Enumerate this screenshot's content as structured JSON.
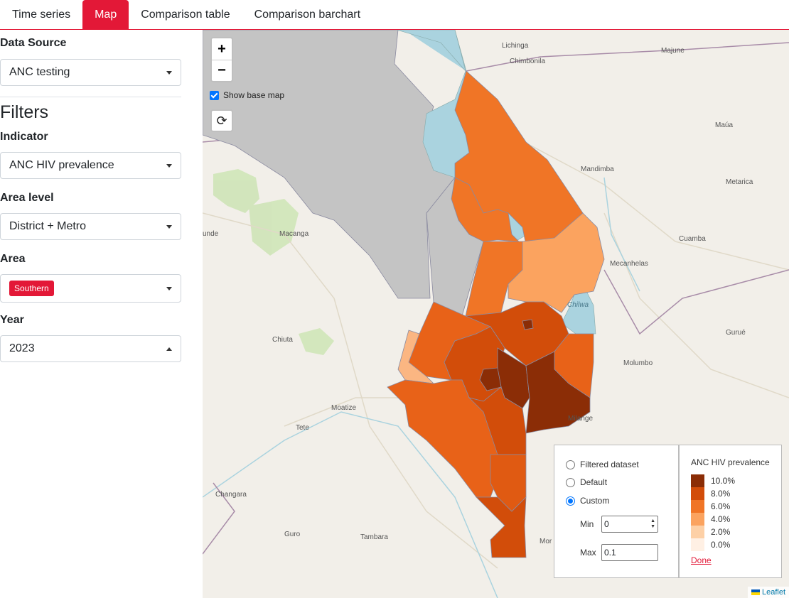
{
  "tabs": [
    {
      "label": "Time series",
      "active": false
    },
    {
      "label": "Map",
      "active": true
    },
    {
      "label": "Comparison table",
      "active": false
    },
    {
      "label": "Comparison barchart",
      "active": false
    }
  ],
  "sidebar": {
    "data_source_label": "Data Source",
    "data_source_value": "ANC testing",
    "filters_heading": "Filters",
    "indicator_label": "Indicator",
    "indicator_value": "ANC HIV prevalence",
    "area_level_label": "Area level",
    "area_level_value": "District + Metro",
    "area_label": "Area",
    "area_chip": "Southern",
    "year_label": "Year",
    "year_value": "2023"
  },
  "map": {
    "zoom_in": "+",
    "zoom_out": "−",
    "show_base_map_label": "Show base map",
    "show_base_map_checked": true,
    "place_names": [
      "Lichinga",
      "Chimbonila",
      "Majune",
      "Maúa",
      "Mandimba",
      "Metarica",
      "Cuamba",
      "Mecanhelas",
      "Macanga",
      "unde",
      "Chiuta",
      "Moatize",
      "Tete",
      "Gurué",
      "Molumbo",
      "Milange",
      "Changara",
      "Guro",
      "Tambara",
      "Mor",
      "Chilwa"
    ],
    "attribution": "Leaflet"
  },
  "scale_options": {
    "filtered_dataset": "Filtered dataset",
    "default": "Default",
    "custom": "Custom",
    "selected": "custom",
    "min_label": "Min",
    "min_value": "0",
    "max_label": "Max",
    "max_value": "0.1"
  },
  "legend": {
    "title": "ANC HIV prevalence",
    "items": [
      {
        "label": "10.0%",
        "color": "#8b2d06"
      },
      {
        "label": "8.0%",
        "color": "#d24d0a"
      },
      {
        "label": "6.0%",
        "color": "#f07526"
      },
      {
        "label": "4.0%",
        "color": "#fba35f"
      },
      {
        "label": "2.0%",
        "color": "#fdd0a6"
      },
      {
        "label": "0.0%",
        "color": "#fff0e4"
      }
    ],
    "done_label": "Done"
  },
  "colors": {
    "accent": "#e31837",
    "lake": "#aad3df",
    "no_data": "#c4c4c4"
  }
}
